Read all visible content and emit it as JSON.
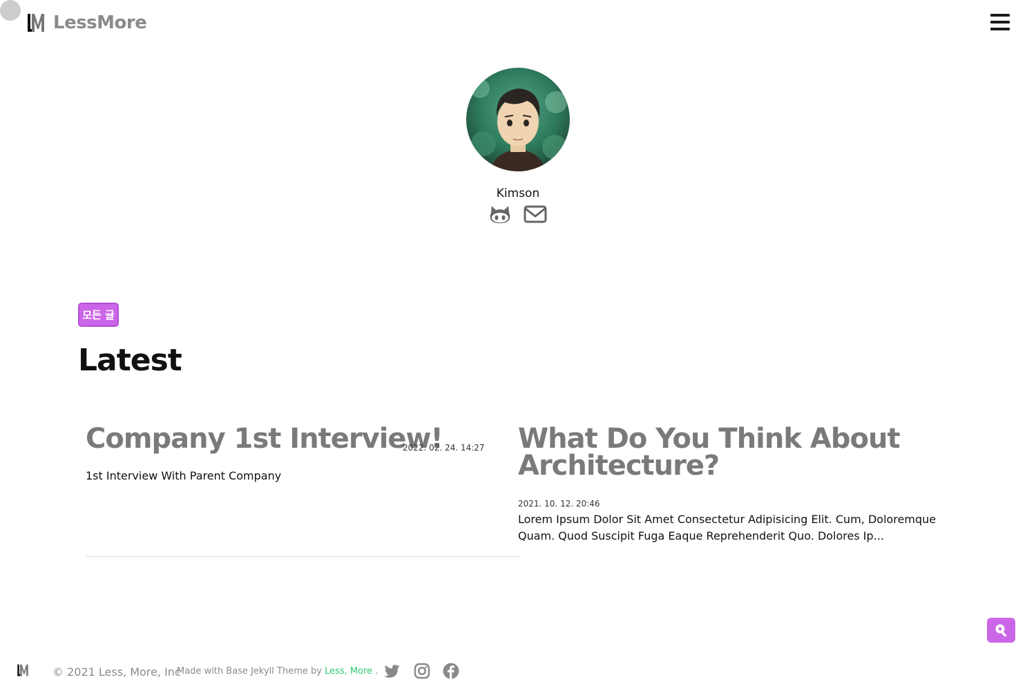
{
  "header": {
    "brand": "LessMore",
    "logo_letters": "LM",
    "menu_icon": "hamburger-icon"
  },
  "profile": {
    "name": "Kimson",
    "links": [
      {
        "icon": "github-icon"
      },
      {
        "icon": "mail-icon"
      }
    ]
  },
  "category_tag": "모든 글",
  "section_title": "Latest",
  "posts": [
    {
      "title": "Company 1st Interview!",
      "date": "2022. 02. 24. 14:27",
      "excerpt": "1st Interview With Parent Company"
    },
    {
      "title": "What Do You Think About Architecture?",
      "date": "2021. 10. 12. 20:46",
      "excerpt": "Lorem Ipsum Dolor Sit Amet Consectetur Adipisicing Elit. Cum, Doloremque Quam. Quod Suscipit Fuga Eaque Reprehenderit Quo. Dolores Ip..."
    }
  ],
  "search_button_icon": "search-zoom-icon",
  "footer": {
    "copyright": "© 2021 Less, More, Inc",
    "made_prefix": "Made with Base Jekyll Theme by",
    "made_link": "Less, More",
    "made_suffix": ".",
    "social": [
      {
        "icon": "twitter-icon"
      },
      {
        "icon": "instagram-icon"
      },
      {
        "icon": "facebook-icon"
      }
    ]
  },
  "colors": {
    "accent": "#cc66e8",
    "link_green": "#2ecc71",
    "title_gray": "#7a7a7a"
  }
}
